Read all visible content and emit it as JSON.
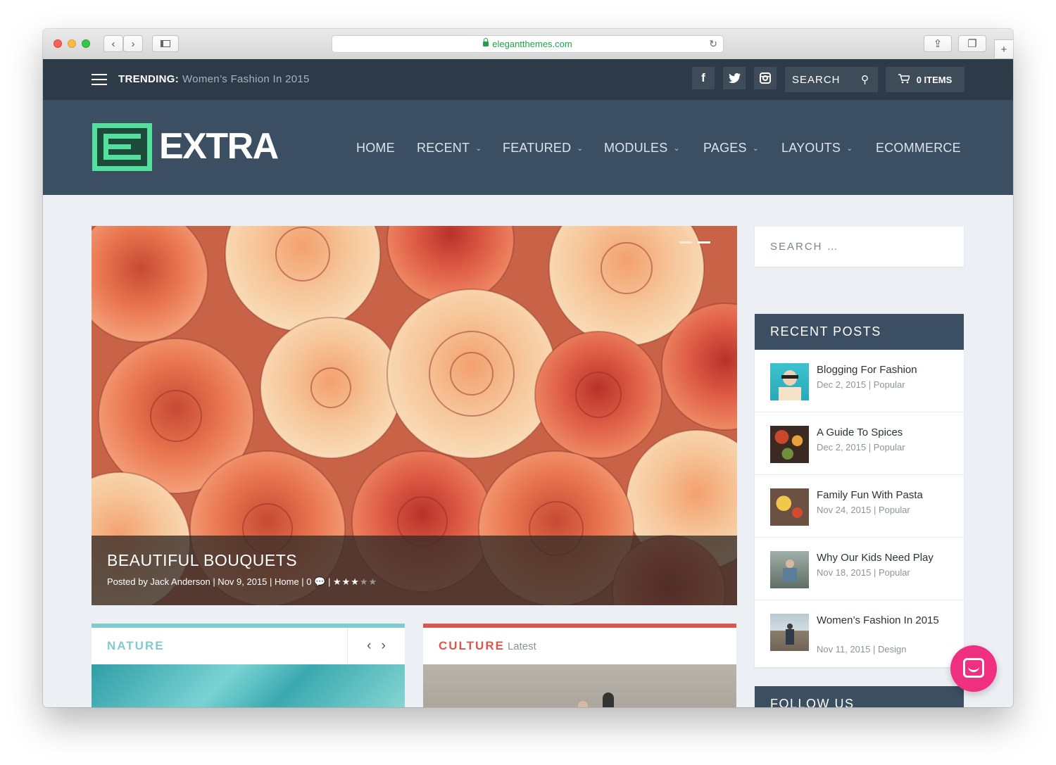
{
  "browser": {
    "url": "elegantthemes.com"
  },
  "topbar": {
    "trending_label": "TRENDING:",
    "trending_value": "Women’s Fashion In 2015",
    "social": [
      "facebook-icon",
      "twitter-icon",
      "instagram-icon"
    ],
    "search_label": "SEARCH",
    "cart_label": "0 ITEMS"
  },
  "header": {
    "logo_text": "EXTRA",
    "nav": [
      {
        "label": "HOME",
        "dropdown": false
      },
      {
        "label": "RECENT",
        "dropdown": true
      },
      {
        "label": "FEATURED",
        "dropdown": true
      },
      {
        "label": "MODULES",
        "dropdown": true
      },
      {
        "label": "PAGES",
        "dropdown": true
      },
      {
        "label": "LAYOUTS",
        "dropdown": true
      },
      {
        "label": "ECOMMERCE",
        "dropdown": false
      }
    ]
  },
  "hero": {
    "title": "BEAUTIFUL BOUQUETS",
    "meta": "Posted by Jack Anderson | Nov 9, 2015 | Home | 0",
    "rating": 3,
    "rating_max": 5
  },
  "cards": [
    {
      "title": "NATURE",
      "subtitle": "",
      "accent": "#7ecbd2"
    },
    {
      "title": "CULTURE",
      "subtitle": "Latest",
      "accent": "#d9574b"
    }
  ],
  "sidebar": {
    "search_placeholder": "SEARCH …",
    "recent_title": "RECENT POSTS",
    "posts": [
      {
        "title": "Blogging For Fashion",
        "date": "Dec 2, 2015",
        "category": "Popular"
      },
      {
        "title": "A Guide To Spices",
        "date": "Dec 2, 2015",
        "category": "Popular"
      },
      {
        "title": "Family Fun With Pasta",
        "date": "Nov 24, 2015",
        "category": "Popular"
      },
      {
        "title": "Why Our Kids Need Play",
        "date": "Nov 18, 2015",
        "category": "Popular"
      },
      {
        "title": "Women’s Fashion In 2015",
        "date": "Nov 11, 2015",
        "category": "Design"
      }
    ],
    "follow_title": "FOLLOW US"
  },
  "colors": {
    "topbar": "#2d3a47",
    "header": "#3b4e62",
    "logo_accent": "#53df9c",
    "chat_button": "#ef2f7f"
  }
}
